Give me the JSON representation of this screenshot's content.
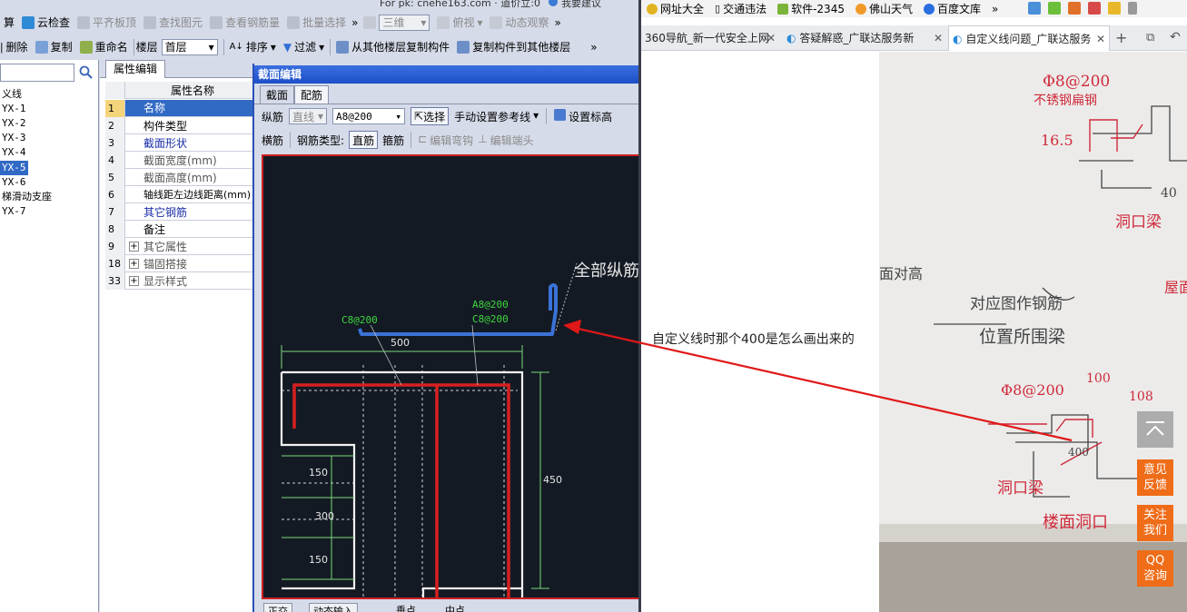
{
  "left_app": {
    "toolbar1": {
      "calc_partial": "算",
      "cloud_check": "云检查",
      "flush_board": "平齐板顶",
      "find_element": "查找图元",
      "view_rebar_qty": "查看钢筋量",
      "batch_select": "批量选择",
      "more": "»",
      "view_3d": "三维",
      "top_view": "俯视",
      "dynamic_observe": "动态观察",
      "more2": "»"
    },
    "top_cut_text": "For pk: cnehe163.com · 道价立:0",
    "top_cut_text2": "我要建议",
    "toolbar2": {
      "delete": "删除",
      "copy": "复制",
      "rename": "重命名",
      "floor_label": "楼层",
      "floor_value": "首层",
      "sort": "排序",
      "filter": "过滤",
      "copy_from_other": "从其他楼层复制构件",
      "copy_to_other": "复制构件到其他楼层",
      "more": "»"
    },
    "tree": {
      "items": [
        {
          "label": "义线"
        },
        {
          "label": "YX-1"
        },
        {
          "label": "YX-2"
        },
        {
          "label": "YX-3"
        },
        {
          "label": "YX-4"
        },
        {
          "label": "YX-5"
        },
        {
          "label": "YX-6"
        },
        {
          "label": "梯滑动支座"
        },
        {
          "label": "YX-7"
        }
      ]
    },
    "property_panel": {
      "tab": "属性编辑",
      "header": "属性名称",
      "rows": [
        {
          "num": "1",
          "name": "名称"
        },
        {
          "num": "2",
          "name": "构件类型"
        },
        {
          "num": "3",
          "name": "截面形状"
        },
        {
          "num": "4",
          "name": "截面宽度(mm)"
        },
        {
          "num": "5",
          "name": "截面高度(mm)"
        },
        {
          "num": "6",
          "name": "轴线距左边线距离(mm)"
        },
        {
          "num": "7",
          "name": "其它钢筋"
        },
        {
          "num": "8",
          "name": "备注"
        },
        {
          "num": "9",
          "name": "其它属性"
        },
        {
          "num": "18",
          "name": "锚固搭接"
        },
        {
          "num": "33",
          "name": "显示样式"
        }
      ]
    },
    "dialog": {
      "title": "截面编辑",
      "tabs": [
        "截面",
        "配筋"
      ],
      "row1": {
        "longitudinal": "纵筋",
        "line_type": "直线",
        "spec": "A8@200",
        "select": "选择",
        "manual_ref_line": "手动设置参考线",
        "set_elevation": "设置标高"
      },
      "row2": {
        "transverse": "横筋",
        "rebar_type_label": "钢筋类型:",
        "straight": "直筋",
        "stirrup": "箍筋",
        "edit_bend": "编辑弯钩",
        "edit_end": "编辑端头"
      },
      "canvas": {
        "all_longitudinal": "全部纵筋",
        "label_c8_left": "C8@200",
        "label_a8": "A8@200",
        "label_c8_right": "C8@200",
        "dim_500": "500",
        "dim_450": "450",
        "dim_150_top": "150",
        "dim_300": "300",
        "dim_150_bottom": "150"
      },
      "status": {
        "ortho": "正交",
        "dynamic_input": "动态输入",
        "snap_vertex": "垂点",
        "snap_mid": "中点"
      }
    }
  },
  "browser": {
    "bookmarks": [
      "网址大全",
      "交通违法",
      "软件-2345",
      "佛山天气",
      "百度文库",
      "»"
    ],
    "tabs": [
      {
        "title": "360导航_新一代安全上网"
      },
      {
        "title": "答疑解惑_广联达服务新"
      },
      {
        "title": "自定义线问题_广联达服务"
      }
    ],
    "question": "自定义线时那个400是怎么画出来的",
    "side_buttons": {
      "feedback": [
        "意见",
        "反馈"
      ],
      "follow": [
        "关注",
        "我们"
      ],
      "qq": [
        "QQ",
        "咨询"
      ]
    },
    "photo_annotations": {
      "top_spec": "Φ8@200",
      "top_note": "不锈钢扁钢",
      "dim_165": "16.5",
      "dim_40": "40",
      "hole_beam": "洞口梁",
      "mid_note1": "对应图作钢筋",
      "mid_note2": "位置所围梁",
      "dim_100": "100",
      "dim_108": "108",
      "spec2": "Φ8@200",
      "dim_400": "400",
      "hole_beam2": "洞口梁",
      "floor_note": "楼面洞口",
      "left_note": "面对高",
      "right_note": "屋面"
    }
  }
}
